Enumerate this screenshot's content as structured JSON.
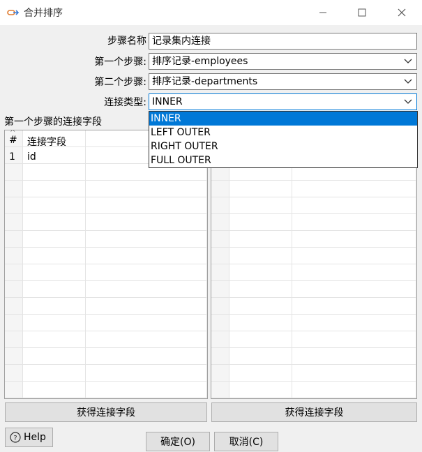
{
  "window": {
    "title": "合并排序",
    "icon": "merge-sort-icon"
  },
  "form": {
    "step_name_label": "步骤名称",
    "step_name_value": "记录集内连接",
    "first_step_label": "第一个步骤:",
    "first_step_value": "排序记录-employees",
    "second_step_label": "第二个步骤:",
    "second_step_value": "排序记录-departments",
    "join_type_label": "连接类型:",
    "join_type_value": "INNER"
  },
  "join_type_options": [
    "INNER",
    "LEFT OUTER",
    "RIGHT OUTER",
    "FULL OUTER"
  ],
  "left_panel": {
    "title": "第一个步骤的连接字段",
    "col_index": "#",
    "col_field": "连接字段",
    "rows": [
      {
        "index": "1",
        "field": "id"
      }
    ],
    "get_fields_button": "获得连接字段"
  },
  "right_panel": {
    "get_fields_button": "获得连接字段"
  },
  "footer": {
    "help_label": "Help",
    "ok_label": "确定(O)",
    "cancel_label": "取消(C)"
  },
  "colors": {
    "selection": "#0078d7",
    "background": "#f0f0f0"
  }
}
